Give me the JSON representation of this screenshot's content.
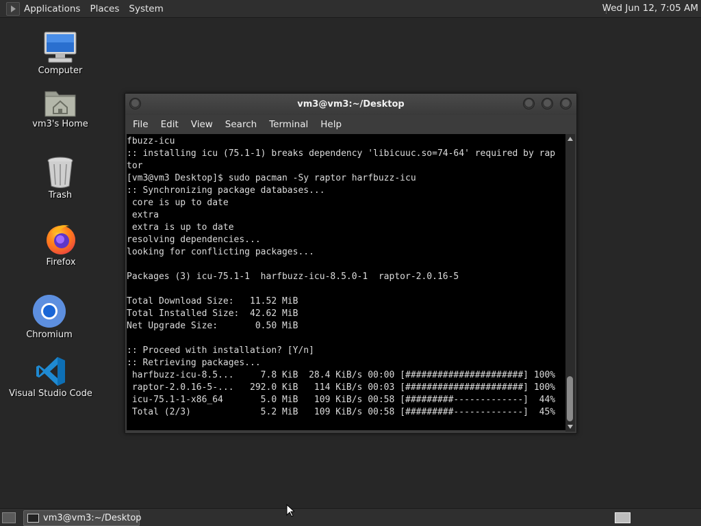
{
  "top_panel": {
    "menus": [
      "Applications",
      "Places",
      "System"
    ],
    "clock": "Wed Jun 12,  7:05 AM"
  },
  "desktop_icons": [
    {
      "label": "Computer",
      "icon": "computer-icon"
    },
    {
      "label": "vm3's Home",
      "icon": "home-folder-icon"
    },
    {
      "label": "Trash",
      "icon": "trash-icon"
    },
    {
      "label": "Firefox",
      "icon": "firefox-icon"
    },
    {
      "label": "Chromium",
      "icon": "chromium-icon"
    },
    {
      "label": "Visual Studio Code",
      "icon": "vscode-icon"
    }
  ],
  "terminal": {
    "title": "vm3@vm3:~/Desktop",
    "menu": [
      "File",
      "Edit",
      "View",
      "Search",
      "Terminal",
      "Help"
    ],
    "lines": [
      "fbuzz-icu",
      ":: installing icu (75.1-1) breaks dependency 'libicuuc.so=74-64' required by rap",
      "tor",
      "[vm3@vm3 Desktop]$ sudo pacman -Sy raptor harfbuzz-icu",
      ":: Synchronizing package databases...",
      " core is up to date",
      " extra",
      " extra is up to date",
      "resolving dependencies...",
      "looking for conflicting packages...",
      "",
      "Packages (3) icu-75.1-1  harfbuzz-icu-8.5.0-1  raptor-2.0.16-5",
      "",
      "Total Download Size:   11.52 MiB",
      "Total Installed Size:  42.62 MiB",
      "Net Upgrade Size:       0.50 MiB",
      "",
      ":: Proceed with installation? [Y/n]",
      ":: Retrieving packages...",
      " harfbuzz-icu-8.5...     7.8 KiB  28.4 KiB/s 00:00 [######################] 100%",
      " raptor-2.0.16-5-...   292.0 KiB   114 KiB/s 00:03 [######################] 100%",
      " icu-75.1-1-x86_64       5.0 MiB   109 KiB/s 00:58 [#########-------------]  44%",
      " Total (2/3)             5.2 MiB   109 KiB/s 00:58 [#########-------------]  45%"
    ]
  },
  "taskbar": {
    "task_label": "vm3@vm3:~/Desktop"
  },
  "colors": {
    "desktop_bg": "#272727",
    "panel_bg": "#2f2f2f",
    "terminal_bg": "#000000",
    "terminal_fg": "#dcdcdc"
  }
}
